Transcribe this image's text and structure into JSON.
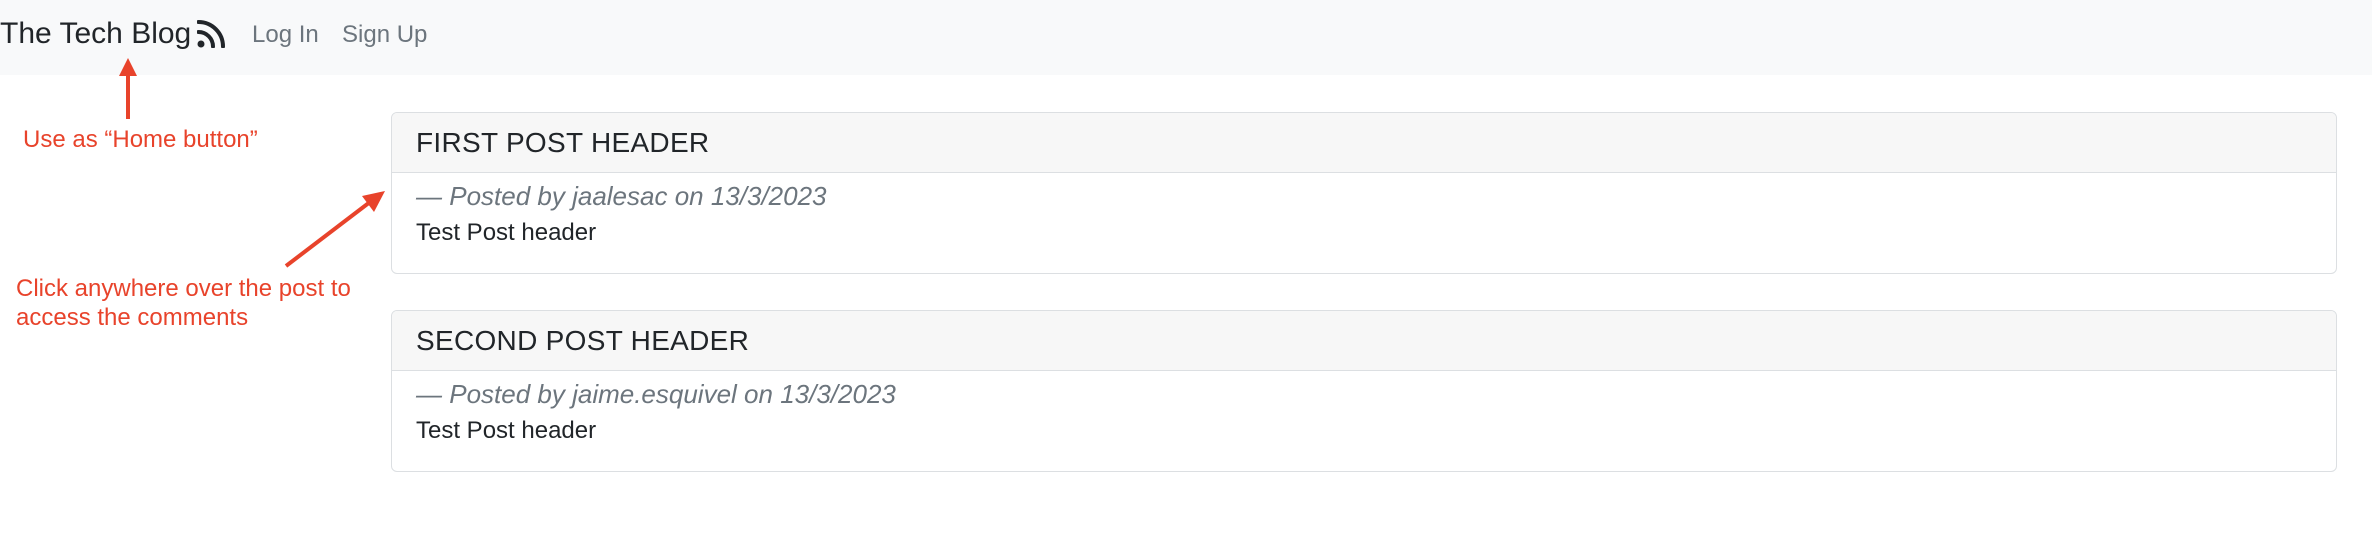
{
  "navbar": {
    "brand": "The Tech Blog",
    "brand_icon": "rss-icon",
    "links": [
      {
        "label": "Log In"
      },
      {
        "label": "Sign Up"
      }
    ]
  },
  "annotations": {
    "home": "Use as “Home button”",
    "click_line1": "Click anywhere over the post to",
    "click_line2": "access the comments",
    "color": "#e8432b"
  },
  "posts": [
    {
      "title": "FIRST POST HEADER",
      "meta": "— Posted by jaalesac on 13/3/2023",
      "body": "Test Post header"
    },
    {
      "title": "SECOND POST HEADER",
      "meta": "— Posted by jaime.esquivel on 13/3/2023",
      "body": "Test Post header"
    }
  ]
}
